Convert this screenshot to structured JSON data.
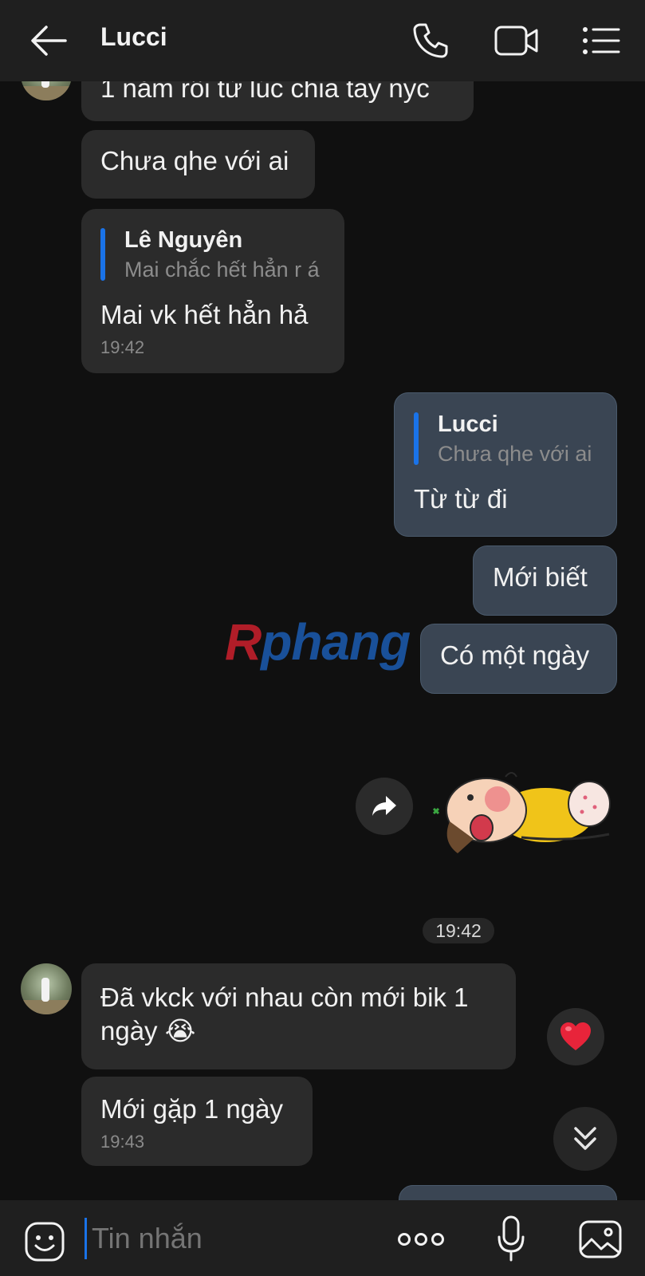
{
  "header": {
    "title": "Lucci",
    "icons": [
      "back-arrow-icon",
      "phone-icon",
      "video-call-icon",
      "menu-list-icon"
    ]
  },
  "messages": {
    "m1": {
      "text": "1 năm rồi từ lúc chia tay nyc"
    },
    "m2": {
      "text": "Chưa qhe với ai"
    },
    "m3": {
      "quote_name": "Lê Nguyên",
      "quote_text": "Mai chắc hết hẳn r á",
      "text": "Mai vk hết hẳn hả",
      "time": "19:42"
    },
    "m4": {
      "quote_name": "Lucci",
      "quote_text": "Chưa qhe với ai",
      "text": "Từ từ đi"
    },
    "m5": {
      "text": "Mới biết"
    },
    "m6": {
      "text": "Có một ngày"
    },
    "m7": {
      "text": "Đã vkck với nhau còn mới bik 1 ngày 😭"
    },
    "m8": {
      "text": "Mới gặp 1 ngày",
      "time": "19:43"
    }
  },
  "time_divider": "19:42",
  "watermark": {
    "part1": "R",
    "part2": "phang"
  },
  "composer": {
    "placeholder": "Tin nhắn"
  },
  "colors": {
    "accent": "#1a73e8",
    "incoming": "#2b2b2b",
    "outgoing": "#3a4553",
    "background": "#101010"
  }
}
